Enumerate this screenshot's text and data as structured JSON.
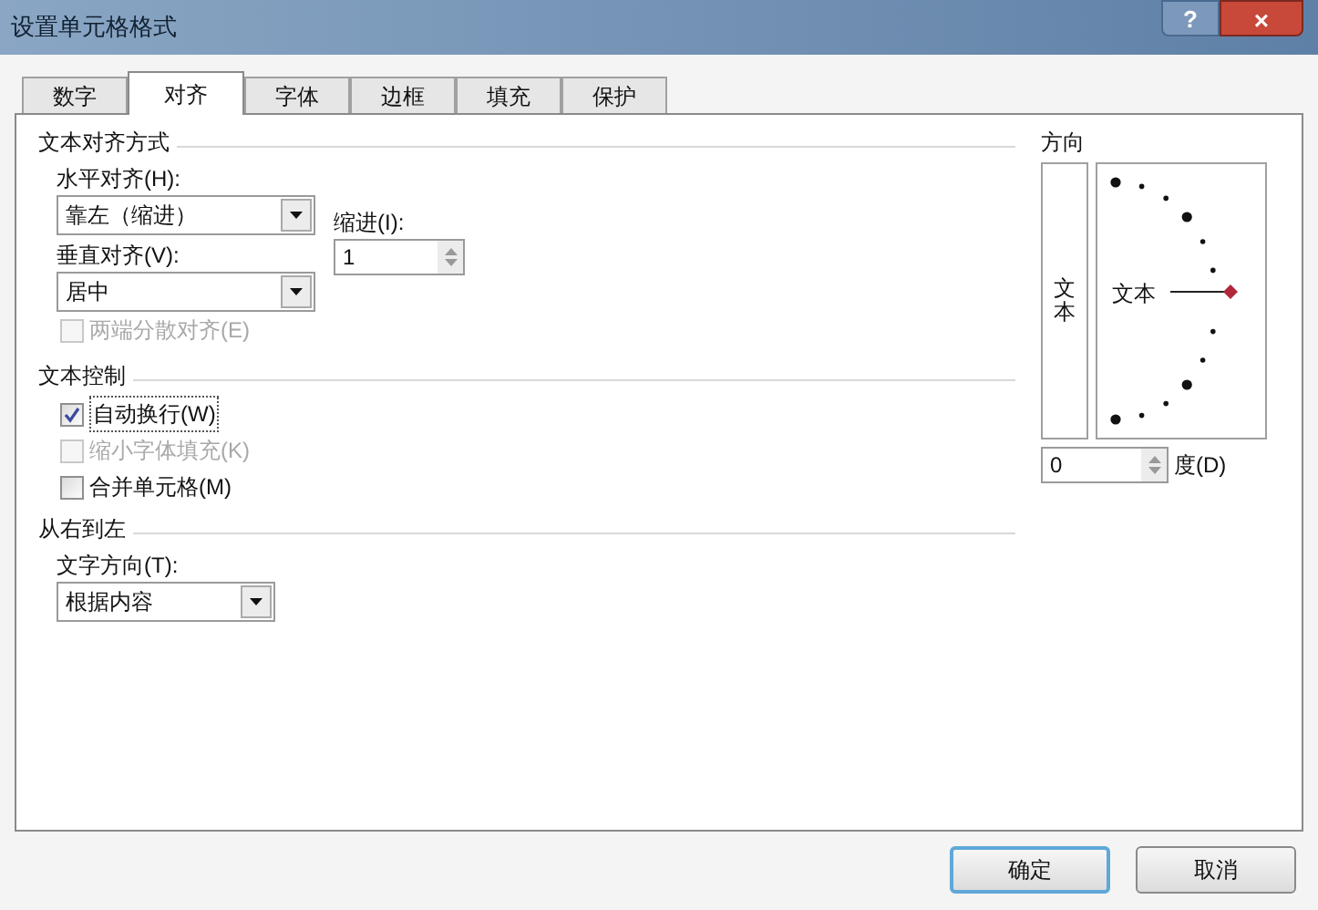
{
  "window": {
    "title": "设置单元格格式",
    "help": "?",
    "close": "×"
  },
  "tabs": [
    {
      "label": "数字",
      "selected": false
    },
    {
      "label": "对齐",
      "selected": true
    },
    {
      "label": "字体",
      "selected": false
    },
    {
      "label": "边框",
      "selected": false
    },
    {
      "label": "填充",
      "selected": false
    },
    {
      "label": "保护",
      "selected": false
    }
  ],
  "text_alignment": {
    "heading": "文本对齐方式",
    "horizontal": {
      "label": "水平对齐(H):",
      "value": "靠左（缩进）"
    },
    "indent": {
      "label": "缩进(I):",
      "value": "1"
    },
    "vertical": {
      "label": "垂直对齐(V):",
      "value": "居中"
    },
    "distributed": {
      "label": "两端分散对齐(E)",
      "checked": false,
      "disabled": true
    }
  },
  "text_control": {
    "heading": "文本控制",
    "options": [
      {
        "label": "自动换行(W)",
        "checked": true,
        "disabled": false
      },
      {
        "label": "缩小字体填充(K)",
        "checked": false,
        "disabled": true
      },
      {
        "label": "合并单元格(M)",
        "checked": false,
        "disabled": false
      }
    ]
  },
  "right_to_left": {
    "heading": "从右到左",
    "direction": {
      "label": "文字方向(T):",
      "value": "根据内容"
    }
  },
  "orientation": {
    "heading": "方向",
    "vertical_text": "文本",
    "dial_text": "文本",
    "degrees": {
      "value": "0",
      "label": "度(D)"
    }
  },
  "buttons": [
    {
      "label": "确定",
      "default": true
    },
    {
      "label": "取消",
      "default": false
    }
  ]
}
